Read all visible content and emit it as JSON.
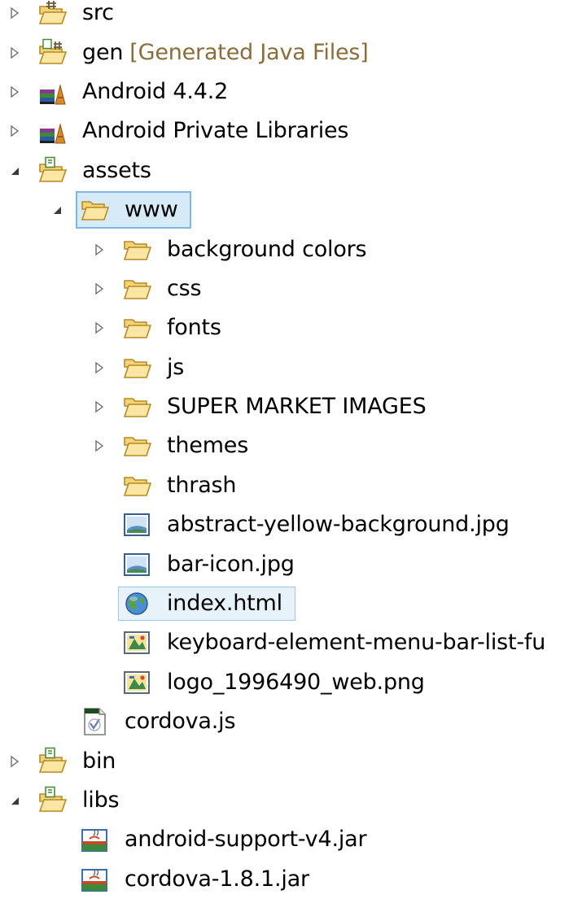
{
  "tree": [
    {
      "label": "src",
      "level": 0,
      "expander": "collapsed",
      "icon": "package-folder-icon"
    },
    {
      "label": "gen",
      "decoration": "[Generated Java Files]",
      "level": 0,
      "expander": "collapsed",
      "icon": "generated-folder-icon"
    },
    {
      "label": "Android 4.4.2",
      "level": 0,
      "expander": "collapsed",
      "icon": "library-icon"
    },
    {
      "label": "Android Private Libraries",
      "level": 0,
      "expander": "collapsed",
      "icon": "library-icon"
    },
    {
      "label": "assets",
      "level": 0,
      "expander": "expanded",
      "icon": "source-folder-icon"
    },
    {
      "label": "www",
      "level": 1,
      "expander": "expanded",
      "icon": "folder-icon",
      "state": "selected"
    },
    {
      "label": "background colors",
      "level": 2,
      "expander": "collapsed",
      "icon": "folder-icon"
    },
    {
      "label": "css",
      "level": 2,
      "expander": "collapsed",
      "icon": "folder-icon"
    },
    {
      "label": "fonts",
      "level": 2,
      "expander": "collapsed",
      "icon": "folder-icon"
    },
    {
      "label": "js",
      "level": 2,
      "expander": "collapsed",
      "icon": "folder-icon"
    },
    {
      "label": "SUPER MARKET IMAGES",
      "level": 2,
      "expander": "collapsed",
      "icon": "folder-icon"
    },
    {
      "label": "themes",
      "level": 2,
      "expander": "collapsed",
      "icon": "folder-icon"
    },
    {
      "label": "thrash",
      "level": 2,
      "expander": "none",
      "icon": "folder-icon"
    },
    {
      "label": "abstract-yellow-background.jpg",
      "level": 2,
      "expander": "none",
      "icon": "image-file-icon"
    },
    {
      "label": "bar-icon.jpg",
      "level": 2,
      "expander": "none",
      "icon": "image-file-icon"
    },
    {
      "label": "index.html",
      "level": 2,
      "expander": "none",
      "icon": "html-file-icon",
      "state": "hover"
    },
    {
      "label": "keyboard-element-menu-bar-list-fu",
      "level": 2,
      "expander": "none",
      "icon": "png-file-icon"
    },
    {
      "label": "logo_1996490_web.png",
      "level": 2,
      "expander": "none",
      "icon": "png-file-icon"
    },
    {
      "label": "cordova.js",
      "level": 1,
      "expander": "none",
      "icon": "js-file-icon"
    },
    {
      "label": "bin",
      "level": 0,
      "expander": "collapsed",
      "icon": "source-folder-icon"
    },
    {
      "label": "libs",
      "level": 0,
      "expander": "expanded",
      "icon": "source-folder-icon"
    },
    {
      "label": "android-support-v4.jar",
      "level": 1,
      "expander": "none",
      "icon": "jar-file-icon"
    },
    {
      "label": "cordova-1.8.1.jar",
      "level": 1,
      "expander": "none",
      "icon": "jar-file-icon"
    }
  ],
  "colors": {
    "folder": "#f3d37a",
    "folder_edge": "#b88a22",
    "selection_fill": "#d6eaf8",
    "selection_border": "#7fb8e6",
    "decoration_text": "#8a6d3b",
    "expander": "#6e6e6e"
  }
}
